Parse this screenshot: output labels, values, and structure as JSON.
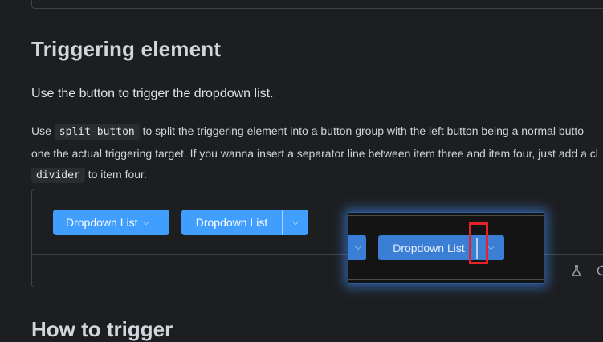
{
  "section": {
    "title": "Triggering element",
    "intro": "Use the button to trigger the dropdown list.",
    "desc_part1": "Use ",
    "code1": "split-button",
    "desc_part2": " to split the triggering element into a button group with the left button being a normal butto",
    "desc_line2": "one the actual triggering target. If you wanna insert a separator line between item three and item four, just add a cl",
    "code2": "divider",
    "desc_part3": " to item four."
  },
  "demo": {
    "button1_label": "Dropdown List",
    "button2_label": "Dropdown List",
    "chevron_glyph": "⌵"
  },
  "zoom": {
    "button_label": "Dropdown List"
  },
  "next_section": {
    "title": "How to trigger"
  },
  "icons": [
    "beaker-icon",
    "github-icon",
    "chevron-down-icon"
  ],
  "colors": {
    "background": "#1d1e1f",
    "primary": "#409eff",
    "border": "#414243",
    "highlight": "#e8202a",
    "glow": "#3c82e6"
  }
}
